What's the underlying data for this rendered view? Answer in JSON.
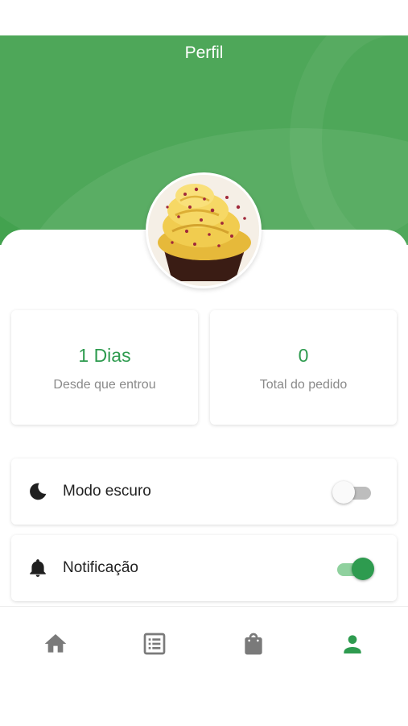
{
  "header": {
    "title": "Perfil",
    "background_color": "#43a24f"
  },
  "avatar": {
    "icon": "cupcake-photo"
  },
  "stats": [
    {
      "value": "1 Dias",
      "label": "Desde que entrou"
    },
    {
      "value": "0",
      "label": "Total do pedido"
    }
  ],
  "settings": [
    {
      "label": "Modo escuro",
      "icon": "moon-icon",
      "enabled": false
    },
    {
      "label": "Notificação",
      "icon": "bell-icon",
      "enabled": true
    }
  ],
  "bottom_nav": [
    {
      "icon": "home-icon",
      "active": false
    },
    {
      "icon": "list-icon",
      "active": false
    },
    {
      "icon": "shopping-bag-icon",
      "active": false
    },
    {
      "icon": "person-icon",
      "active": true
    }
  ],
  "colors": {
    "accent": "#2e9b4f",
    "inactive_icon": "#7a7a7a",
    "label": "#8a8a8a"
  }
}
